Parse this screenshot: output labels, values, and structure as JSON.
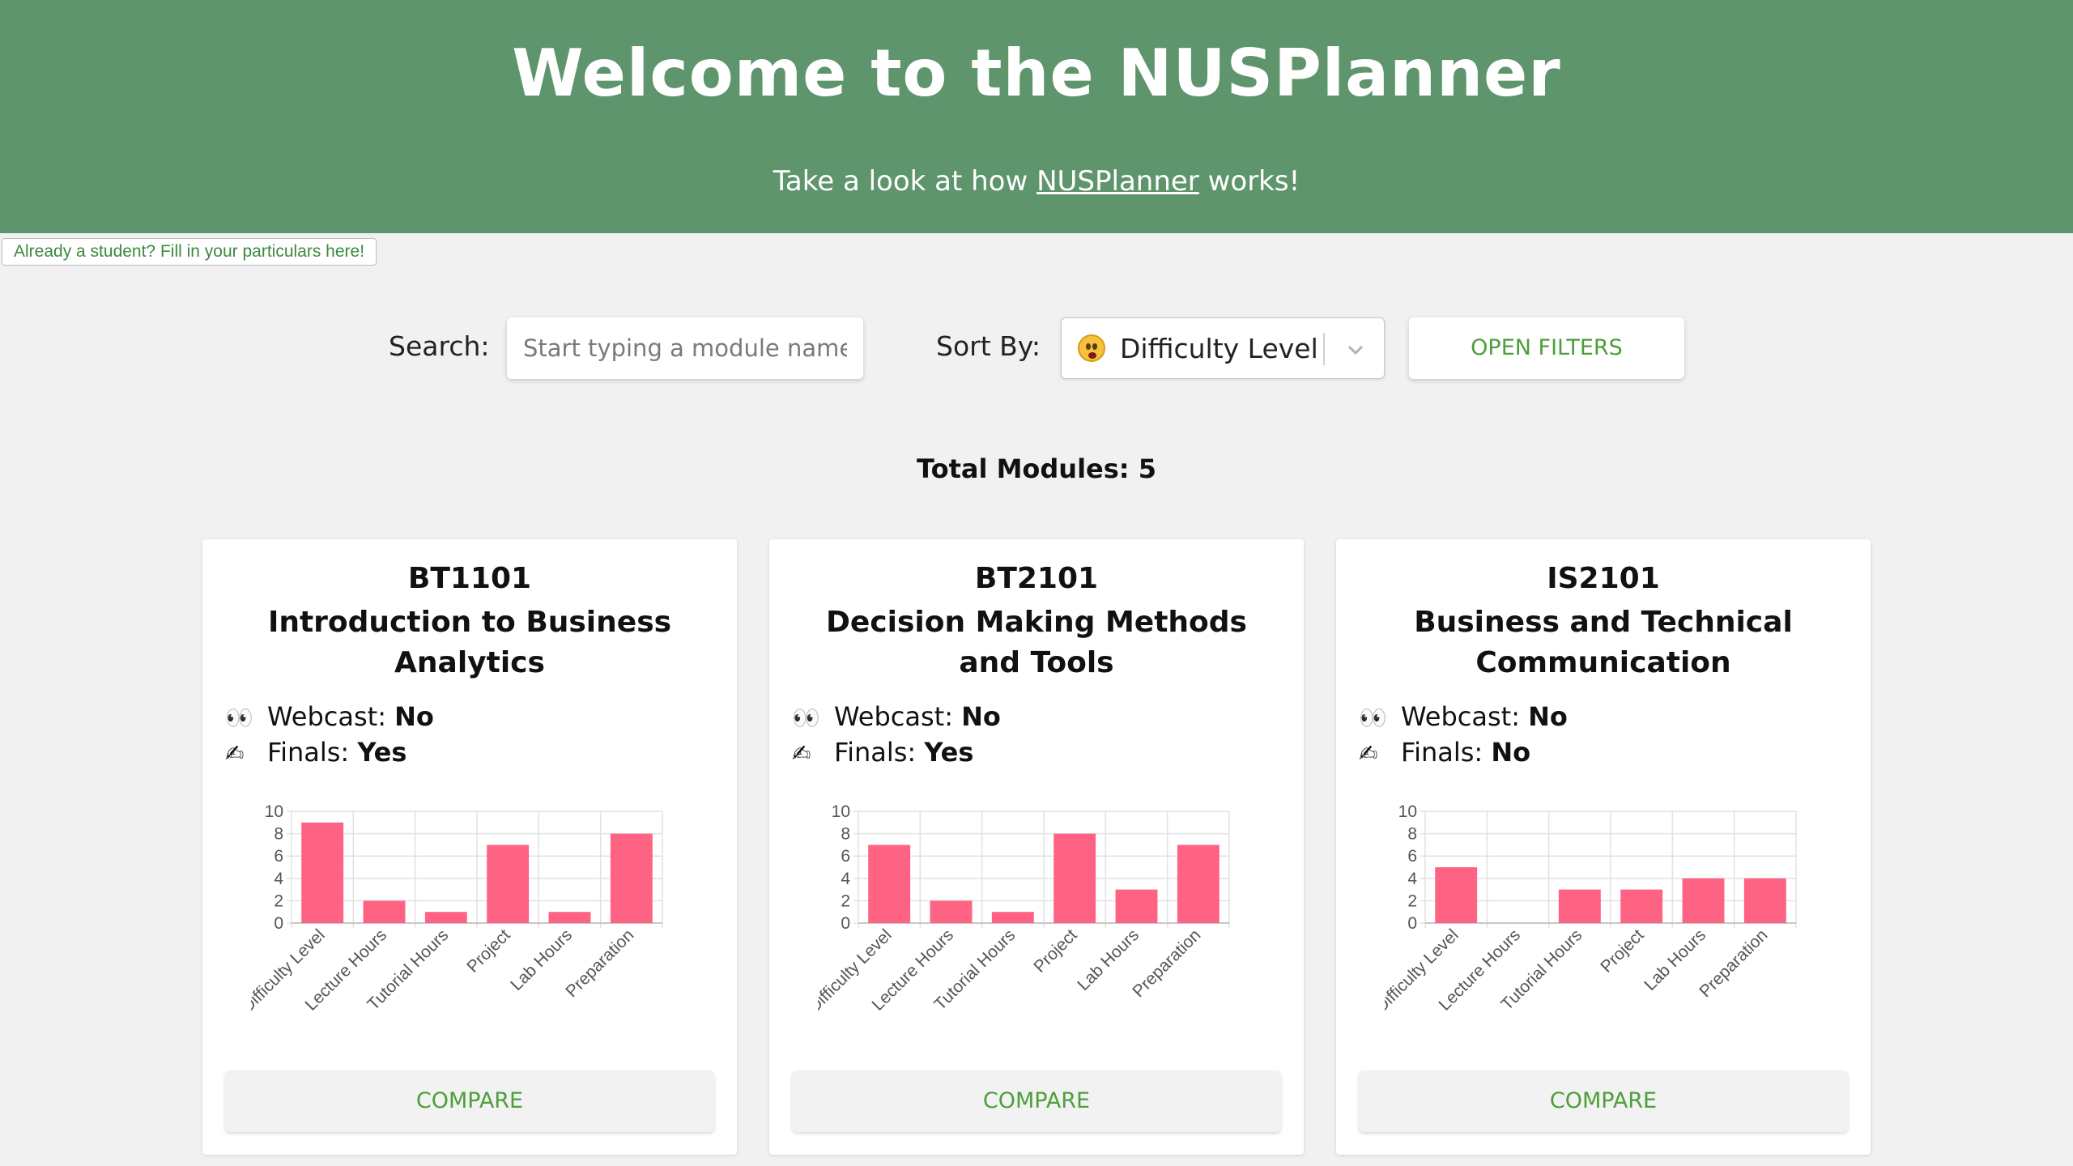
{
  "header": {
    "title": "Welcome to the NUSPlanner",
    "subtitle_before": "Take a look at how ",
    "subtitle_link": "NUSPlanner",
    "subtitle_after": " works!"
  },
  "student_link": "Already a student? Fill in your particulars here!",
  "toolbar": {
    "search_label": "Search:",
    "search_placeholder": "Start typing a module name.",
    "sort_label": "Sort By:",
    "sort_value": "Difficulty Level",
    "sort_icon": "astonished-face-emoji",
    "filters_button": "OPEN FILTERS"
  },
  "total_modules": "Total Modules: 5",
  "labels": {
    "webcast": "Webcast: ",
    "finals": "Finals: ",
    "compare": "COMPARE",
    "webcast_icon": "eyes-emoji",
    "finals_icon": "writing-hand-emoji"
  },
  "accent_colors": {
    "header": "#5f956d",
    "bar": "#ff6384",
    "button_text": "#4e9e3a"
  },
  "chart_data": [
    {
      "type": "bar",
      "categories": [
        "Difficulty Level",
        "Lecture Hours",
        "Tutorial Hours",
        "Project",
        "Lab Hours",
        "Preparation"
      ],
      "series": [
        {
          "values": [
            9,
            2,
            1,
            7,
            1,
            8
          ]
        }
      ],
      "yticks": [
        "0",
        "2",
        "4",
        "6",
        "8",
        "10"
      ],
      "ylim": [
        0,
        10
      ],
      "grid": true
    },
    {
      "type": "bar",
      "categories": [
        "Difficulty Level",
        "Lecture Hours",
        "Tutorial Hours",
        "Project",
        "Lab Hours",
        "Preparation"
      ],
      "series": [
        {
          "values": [
            7,
            2,
            1,
            8,
            3,
            7
          ]
        }
      ],
      "yticks": [
        "0",
        "2",
        "4",
        "6",
        "8",
        "10"
      ],
      "ylim": [
        0,
        10
      ],
      "grid": true
    },
    {
      "type": "bar",
      "categories": [
        "Difficulty Level",
        "Lecture Hours",
        "Tutorial Hours",
        "Project",
        "Lab Hours",
        "Preparation"
      ],
      "series": [
        {
          "values": [
            5,
            0,
            3,
            3,
            4,
            4
          ]
        }
      ],
      "yticks": [
        "0",
        "2",
        "4",
        "6",
        "8",
        "10"
      ],
      "ylim": [
        0,
        10
      ],
      "grid": true
    }
  ],
  "modules": [
    {
      "code": "BT1101",
      "title": "Introduction to Business Analytics",
      "webcast": "No",
      "finals": "Yes"
    },
    {
      "code": "BT2101",
      "title": "Decision Making Methods and Tools",
      "webcast": "No",
      "finals": "Yes"
    },
    {
      "code": "IS2101",
      "title": "Business and Technical Communication",
      "webcast": "No",
      "finals": "No"
    }
  ]
}
